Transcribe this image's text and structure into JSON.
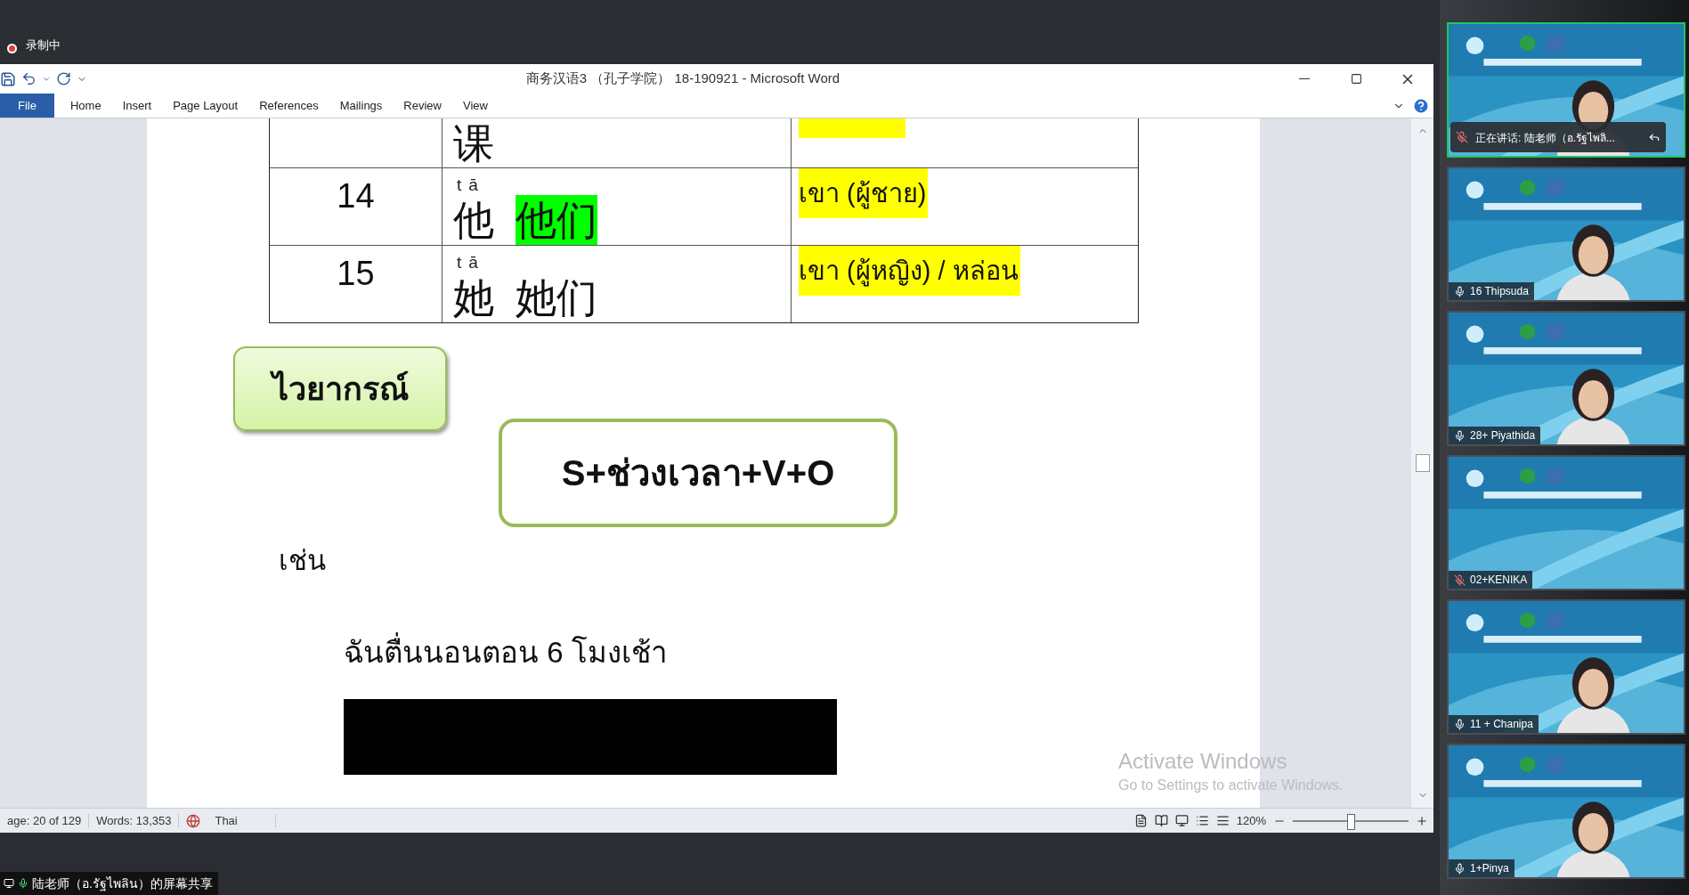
{
  "meeting_bar": {
    "recording_label": "录制中"
  },
  "window": {
    "title": "商务汉语3 （孔子学院） 18-190921 - Microsoft Word"
  },
  "ribbon_tabs": [
    {
      "label": "File",
      "selected": true
    },
    {
      "label": "Home",
      "selected": false
    },
    {
      "label": "Insert",
      "selected": false
    },
    {
      "label": "Page Layout",
      "selected": false
    },
    {
      "label": "References",
      "selected": false
    },
    {
      "label": "Mailings",
      "selected": false
    },
    {
      "label": "Review",
      "selected": false
    },
    {
      "label": "View",
      "selected": false
    }
  ],
  "table": {
    "rows": [
      {
        "number": "",
        "hanzi": [
          {
            "text": "课",
            "highlighted": false
          }
        ],
        "meaning": "",
        "meaning_highlighted": true
      },
      {
        "number": "14",
        "hanzi": [
          {
            "text": "他",
            "pinyin": "tā",
            "highlighted": false
          },
          {
            "text": "他们",
            "highlighted": true
          }
        ],
        "meaning": "เขา (ผู้ชาย)",
        "meaning_highlighted": true
      },
      {
        "number": "15",
        "hanzi": [
          {
            "text": "她",
            "pinyin": "tā",
            "highlighted": false
          },
          {
            "text": "她们",
            "highlighted": false
          }
        ],
        "meaning": "เขา (ผู้หญิง) / หล่อน",
        "meaning_highlighted": true
      }
    ]
  },
  "grammar_label": "ไวยากรณ์",
  "formula": "S+ช่วงเวลา+V+O",
  "example_label": "เช่น",
  "example_sentence": "ฉันตื่นนอนตอน 6 โมงเช้า",
  "activation_notice": {
    "title": "Activate Windows",
    "subtitle": "Go to Settings to activate Windows."
  },
  "status_bar": {
    "page": "age: 20 of 129",
    "words": "Words: 13,353",
    "language": "Thai",
    "zoom": "120%",
    "level": 0.5
  },
  "screen_share_label": "陆老师（อ.รัฐไพลิน）的屏幕共享",
  "participants": [
    {
      "name": "正在讲话: 陆老师（อ.รัฐไพลิ...",
      "muted": true,
      "selected": true,
      "speaking": true
    },
    {
      "name": "16 Thipsuda",
      "muted": false,
      "selected": false,
      "speaking": false
    },
    {
      "name": "28+ Piyathida",
      "muted": false,
      "selected": false,
      "speaking": false
    },
    {
      "name": "02+KENIKA",
      "muted": true,
      "selected": false,
      "speaking": false
    },
    {
      "name": "11 + Chanipa",
      "muted": false,
      "selected": false,
      "speaking": false
    },
    {
      "name": "1+Pinya",
      "muted": false,
      "selected": false,
      "speaking": false
    }
  ]
}
